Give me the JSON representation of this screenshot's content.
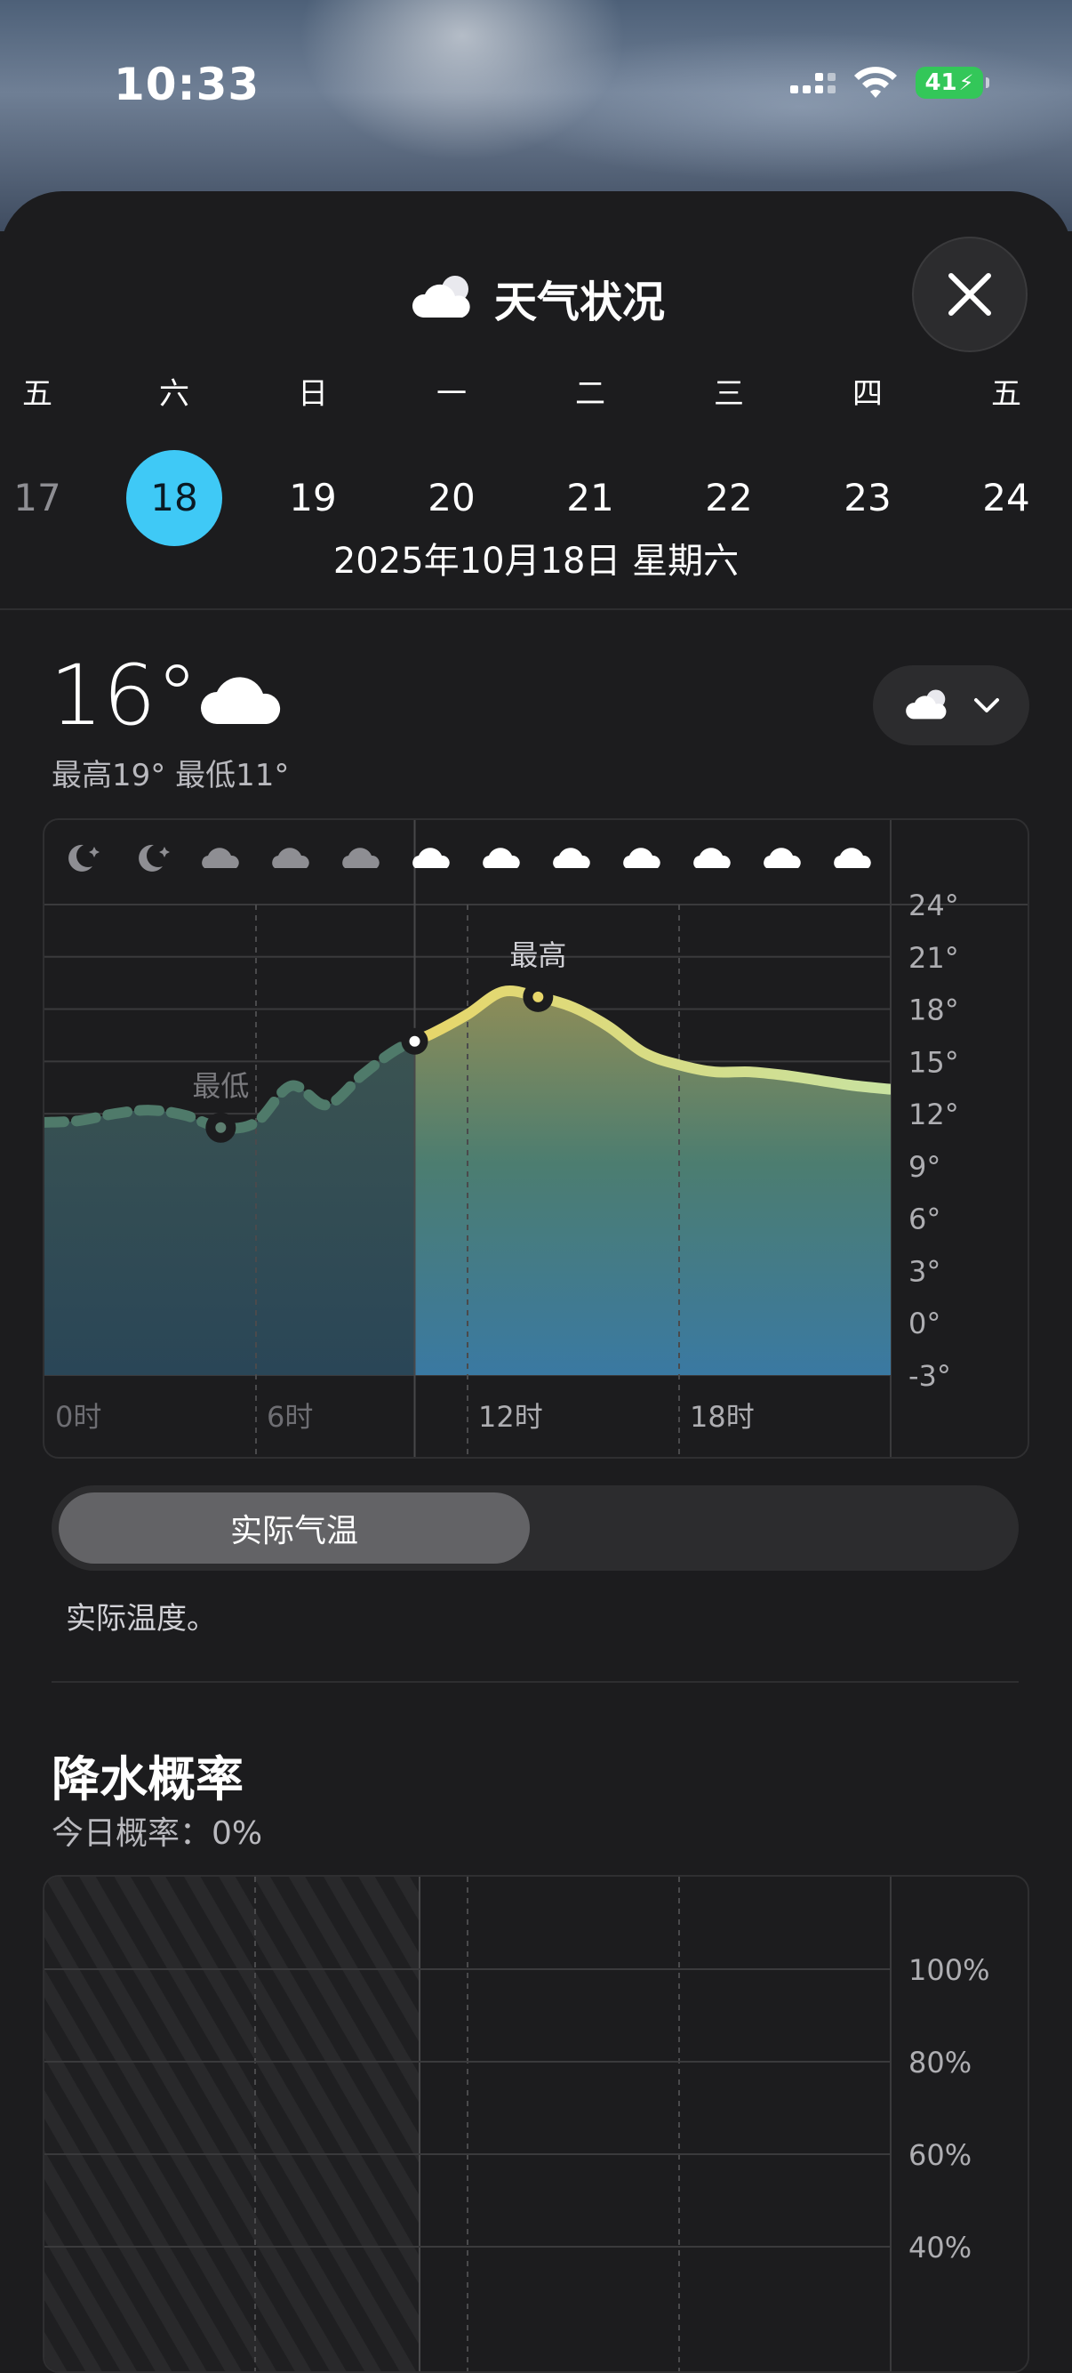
{
  "status_bar": {
    "time": "10:33",
    "battery": "41"
  },
  "sheet": {
    "title": "天气状况"
  },
  "week": [
    {
      "weekday": "五",
      "day": "17",
      "state": "past"
    },
    {
      "weekday": "六",
      "day": "18",
      "state": "selected"
    },
    {
      "weekday": "日",
      "day": "19",
      "state": "future"
    },
    {
      "weekday": "一",
      "day": "20",
      "state": "future"
    },
    {
      "weekday": "二",
      "day": "21",
      "state": "future"
    },
    {
      "weekday": "三",
      "day": "22",
      "state": "future"
    },
    {
      "weekday": "四",
      "day": "23",
      "state": "future"
    },
    {
      "weekday": "五",
      "day": "24",
      "state": "future"
    }
  ],
  "date_line": "2025年10月18日 星期六",
  "current": {
    "temp": "16°",
    "hilo": "最高19° 最低11°",
    "condition_icon": "cloud-icon"
  },
  "colors": {
    "selected_day": "#3fc9f6",
    "high_line": "#e7d66a",
    "past_line": "#4f7a6a",
    "fill_top": "#8f8d57",
    "fill_bottom": "#3a79a2"
  },
  "chart_data": {
    "type": "area",
    "x": [
      0,
      1,
      2,
      3,
      4,
      5,
      6,
      7,
      8,
      9,
      10,
      11,
      12,
      13,
      14,
      15,
      16,
      17,
      18,
      19,
      20,
      21,
      22,
      23,
      24
    ],
    "y": [
      11.5,
      11.6,
      12,
      12.2,
      11.9,
      11.2,
      11.5,
      13.6,
      12.5,
      14.2,
      15.7,
      16.6,
      17.7,
      19.0,
      18.7,
      18.1,
      17.0,
      15.5,
      14.8,
      14.4,
      14.4,
      14.2,
      13.9,
      13.6,
      13.4
    ],
    "now_hour": 10.5,
    "yticks": [
      "24°",
      "21°",
      "18°",
      "15°",
      "12°",
      "9°",
      "6°",
      "3°",
      "0°",
      "-3°"
    ],
    "ylim": [
      -3,
      24
    ],
    "xticks": [
      {
        "label": "0时",
        "hour": 0
      },
      {
        "label": "6时",
        "hour": 6
      },
      {
        "label": "12时",
        "hour": 12
      },
      {
        "label": "18时",
        "hour": 18
      }
    ],
    "annotations": [
      {
        "label": "最高",
        "hour": 14,
        "value": 19
      },
      {
        "label": "最低",
        "hour": 5,
        "value": 11
      }
    ],
    "hour_icons": [
      "moon-icon",
      "moon-icon",
      "cloud-icon",
      "cloud-icon",
      "cloud-icon",
      "cloud-icon",
      "cloud-icon",
      "cloud-icon",
      "cloud-icon",
      "cloud-icon",
      "cloud-icon",
      "cloud-icon"
    ]
  },
  "segment": {
    "active": "实际气温"
  },
  "segment_desc": "实际温度。",
  "precip": {
    "title": "降水概率",
    "subtitle": "今日概率：0%",
    "chart_data": {
      "type": "bar",
      "yticks": [
        "100%",
        "80%",
        "60%",
        "40%"
      ],
      "ylim": [
        0,
        100
      ],
      "values": []
    }
  }
}
